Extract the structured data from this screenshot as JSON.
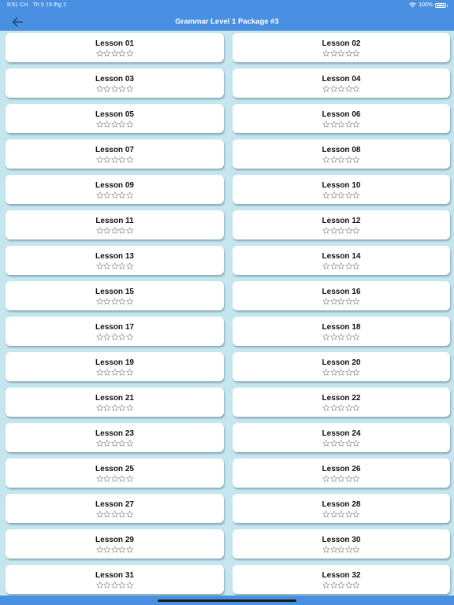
{
  "status_bar": {
    "time": "8:51 CH",
    "date": "Th 5 15 thg 2",
    "battery": "100%",
    "battery_level": 1.0
  },
  "header": {
    "title": "Grammar Level 1 Package #3",
    "back_icon": "arrow-left-icon"
  },
  "colors": {
    "header_bg": "#4a90e2",
    "page_bg": "#c5e6ee",
    "card_bg": "#ffffff"
  },
  "lessons": [
    {
      "label": "Lesson 01",
      "stars": 0
    },
    {
      "label": "Lesson 02",
      "stars": 0
    },
    {
      "label": "Lesson 03",
      "stars": 0
    },
    {
      "label": "Lesson 04",
      "stars": 0
    },
    {
      "label": "Lesson 05",
      "stars": 0
    },
    {
      "label": "Lesson 06",
      "stars": 0
    },
    {
      "label": "Lesson 07",
      "stars": 0
    },
    {
      "label": "Lesson 08",
      "stars": 0
    },
    {
      "label": "Lesson 09",
      "stars": 0
    },
    {
      "label": "Lesson 10",
      "stars": 0
    },
    {
      "label": "Lesson 11",
      "stars": 0
    },
    {
      "label": "Lesson 12",
      "stars": 0
    },
    {
      "label": "Lesson 13",
      "stars": 0
    },
    {
      "label": "Lesson 14",
      "stars": 0
    },
    {
      "label": "Lesson 15",
      "stars": 0
    },
    {
      "label": "Lesson 16",
      "stars": 0
    },
    {
      "label": "Lesson 17",
      "stars": 0
    },
    {
      "label": "Lesson 18",
      "stars": 0
    },
    {
      "label": "Lesson 19",
      "stars": 0
    },
    {
      "label": "Lesson 20",
      "stars": 0
    },
    {
      "label": "Lesson 21",
      "stars": 0
    },
    {
      "label": "Lesson 22",
      "stars": 0
    },
    {
      "label": "Lesson 23",
      "stars": 0
    },
    {
      "label": "Lesson 24",
      "stars": 0
    },
    {
      "label": "Lesson 25",
      "stars": 0
    },
    {
      "label": "Lesson 26",
      "stars": 0
    },
    {
      "label": "Lesson 27",
      "stars": 0
    },
    {
      "label": "Lesson 28",
      "stars": 0
    },
    {
      "label": "Lesson 29",
      "stars": 0
    },
    {
      "label": "Lesson 30",
      "stars": 0
    },
    {
      "label": "Lesson 31",
      "stars": 0
    },
    {
      "label": "Lesson 32",
      "stars": 0
    }
  ],
  "max_stars": 5
}
